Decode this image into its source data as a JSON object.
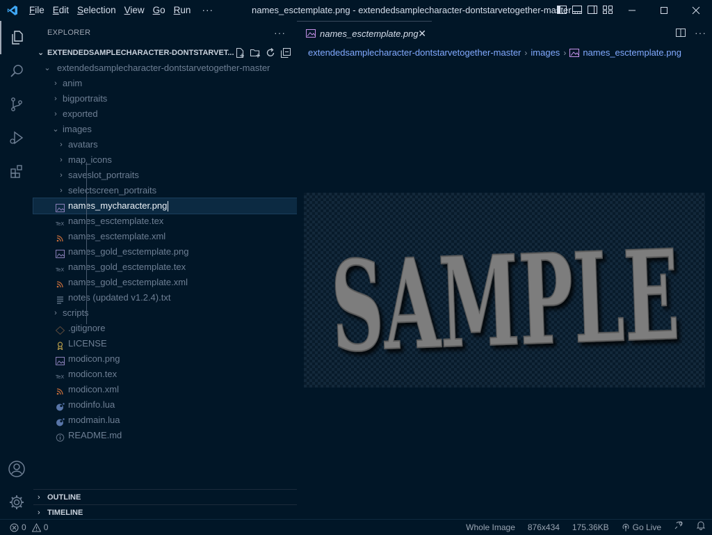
{
  "titlebar": {
    "menus": [
      {
        "mnemonic": "F",
        "rest": "ile"
      },
      {
        "mnemonic": "E",
        "rest": "dit"
      },
      {
        "mnemonic": "S",
        "rest": "election"
      },
      {
        "mnemonic": "V",
        "rest": "iew"
      },
      {
        "mnemonic": "G",
        "rest": "o"
      },
      {
        "mnemonic": "R",
        "rest": "un"
      }
    ],
    "more": "···",
    "title": "names_esctemplate.png - extendedsamplecharacter-dontstarvetogether-master ..."
  },
  "sidebar": {
    "header": "EXPLORER",
    "more": "···",
    "workspace": "EXTENDEDSAMPLECHARACTER-DONTSTARVET...",
    "items": [
      {
        "label": "extendedsamplecharacter-dontstarvetogether-master",
        "twisty": "⌄",
        "icon": "",
        "level": 0
      },
      {
        "label": "anim",
        "twisty": "›",
        "icon": "",
        "level": 1
      },
      {
        "label": "bigportraits",
        "twisty": "›",
        "icon": "",
        "level": 1
      },
      {
        "label": "exported",
        "twisty": "›",
        "icon": "",
        "level": 1
      },
      {
        "label": "images",
        "twisty": "⌄",
        "icon": "",
        "level": 1
      },
      {
        "label": "avatars",
        "twisty": "›",
        "icon": "",
        "level": 2
      },
      {
        "label": "map_icons",
        "twisty": "›",
        "icon": "",
        "level": 2
      },
      {
        "label": "saveslot_portraits",
        "twisty": "›",
        "icon": "",
        "level": 2
      },
      {
        "label": "selectscreen_portraits",
        "twisty": "›",
        "icon": "",
        "level": 2
      },
      {
        "label": "names_mycharacter.png",
        "twisty": "",
        "icon": "image-icon",
        "level": 2,
        "selected": true
      },
      {
        "label": "names_esctemplate.tex",
        "twisty": "",
        "icon": "tex-icon",
        "level": 2
      },
      {
        "label": "names_esctemplate.xml",
        "twisty": "",
        "icon": "rss-icon",
        "level": 2
      },
      {
        "label": "names_gold_esctemplate.png",
        "twisty": "",
        "icon": "image-icon",
        "level": 2
      },
      {
        "label": "names_gold_esctemplate.tex",
        "twisty": "",
        "icon": "tex-icon",
        "level": 2
      },
      {
        "label": "names_gold_esctemplate.xml",
        "twisty": "",
        "icon": "rss-icon",
        "level": 2
      },
      {
        "label": "notes (updated v1.2.4).txt",
        "twisty": "",
        "icon": "text-icon",
        "level": 2
      },
      {
        "label": "scripts",
        "twisty": "›",
        "icon": "",
        "level": 1
      },
      {
        "label": ".gitignore",
        "twisty": "",
        "icon": "git-icon",
        "level": 1
      },
      {
        "label": "LICENSE",
        "twisty": "",
        "icon": "license-icon",
        "level": 1
      },
      {
        "label": "modicon.png",
        "twisty": "",
        "icon": "image-icon",
        "level": 1
      },
      {
        "label": "modicon.tex",
        "twisty": "",
        "icon": "tex-icon",
        "level": 1
      },
      {
        "label": "modicon.xml",
        "twisty": "",
        "icon": "rss-icon",
        "level": 1
      },
      {
        "label": "modinfo.lua",
        "twisty": "",
        "icon": "lua-icon",
        "level": 1
      },
      {
        "label": "modmain.lua",
        "twisty": "",
        "icon": "lua-icon",
        "level": 1
      },
      {
        "label": "README.md",
        "twisty": "",
        "icon": "info-icon",
        "level": 1
      }
    ],
    "outline": "OUTLINE",
    "timeline": "TIMELINE"
  },
  "editor": {
    "tab_label": "names_esctemplate.png",
    "breadcrumb": [
      "extendedsamplecharacter-dontstarvetogether-master",
      "images",
      "names_esctemplate.png"
    ],
    "image_text": "SAMPLE"
  },
  "statusbar": {
    "errors": "0",
    "warnings": "0",
    "zoom": "Whole Image",
    "dimensions": "876x434",
    "size": "175.36KB",
    "golive": "Go Live"
  },
  "colors": {
    "background": "#011627",
    "accent": "#82aaff",
    "selected_row": "#0c2a42"
  }
}
